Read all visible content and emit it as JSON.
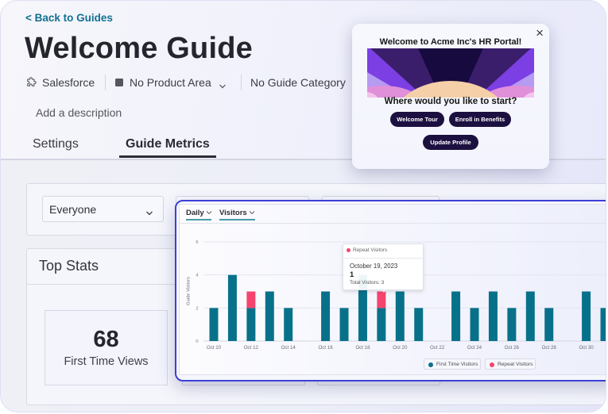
{
  "nav": {
    "back_label": "< Back to Guides"
  },
  "guide": {
    "title": "Welcome Guide",
    "description_placeholder": "Add a description"
  },
  "meta": {
    "integration": "Salesforce",
    "integration_icon": "puzzle-icon",
    "product_area": "No Product Area",
    "product_area_icon": "square-icon",
    "guide_category": "No Guide Category"
  },
  "tabs": [
    {
      "label": "Settings",
      "active": false
    },
    {
      "label": "Guide Metrics",
      "active": true
    }
  ],
  "filters": {
    "audience": "Everyone"
  },
  "top_stats": {
    "heading": "Top Stats",
    "stats": [
      {
        "value": "68",
        "label": "First Time Views"
      }
    ]
  },
  "chart_controls": {
    "interval": "Daily",
    "metric": "Visitors"
  },
  "popup": {
    "title": "Welcome to Acme Inc's HR Portal!",
    "subtitle": "Where would you like to start?",
    "close_icon": "close-icon",
    "buttons": [
      "Welcome Tour",
      "Enroll in Benefits",
      "Update Profile"
    ]
  },
  "colors": {
    "link": "#137090",
    "chart_highlight_border": "#3d3fd6",
    "first_time_visitors": "#08718a",
    "repeat_visitors": "#f5446f",
    "popup_button": "#1c1040"
  },
  "chart_data": {
    "type": "bar",
    "stacked": true,
    "title": "",
    "xlabel": "",
    "ylabel": "Guide Visitors",
    "ylim": [
      0,
      6
    ],
    "y_ticks": [
      "0",
      "2",
      "4",
      "6"
    ],
    "grid": true,
    "legend_position": "bottom-right",
    "categories": [
      "Oct 10",
      "Oct 11",
      "Oct 12",
      "Oct 13",
      "Oct 14",
      "Oct 15",
      "Oct 16",
      "Oct 17",
      "Oct 18",
      "Oct 19",
      "Oct 20",
      "Oct 21",
      "Oct 22",
      "Oct 23",
      "Oct 24",
      "Oct 25",
      "Oct 26",
      "Oct 27",
      "Oct 28",
      "Oct 29",
      "Oct 30",
      "Oct 31"
    ],
    "x_tick_labels": [
      "Oct 10",
      "Oct 12",
      "Oct 14",
      "Oct 16",
      "Oct 18",
      "Oct 20",
      "Oct 22",
      "Oct 24",
      "Oct 26",
      "Oct 28",
      "Oct 30"
    ],
    "series": [
      {
        "name": "First Time Visitors",
        "color": "#08718a",
        "values": [
          2,
          4,
          2,
          3,
          2,
          0,
          3,
          2,
          4,
          2,
          3,
          2,
          0,
          3,
          2,
          3,
          2,
          3,
          2,
          0,
          3,
          2
        ]
      },
      {
        "name": "Repeat Visitors",
        "color": "#f5446f",
        "values": [
          0,
          0,
          1,
          0,
          0,
          0,
          0,
          0,
          0,
          1,
          0,
          0,
          0,
          0,
          0,
          0,
          0,
          0,
          0,
          0,
          0,
          0
        ]
      }
    ],
    "tooltip": {
      "series": "Repeat Visitors",
      "date": "October 19, 2023",
      "value": "1",
      "total": "Total Visitors: 3"
    }
  }
}
